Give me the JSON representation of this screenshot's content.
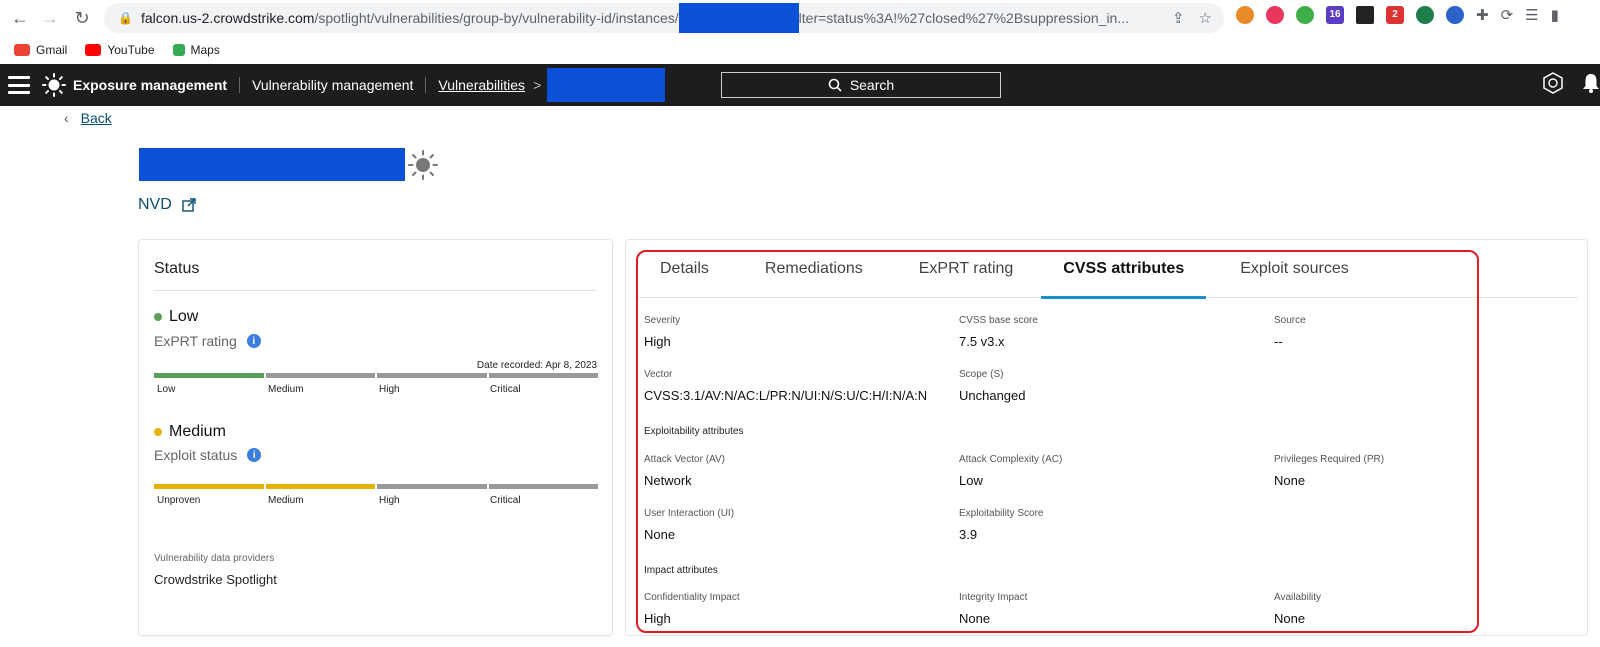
{
  "browser": {
    "url_host": "falcon.us-2.crowdstrike.com",
    "url_path": "/spotlight/vulnerabilities/group-by/vulnerability-id/instances/",
    "url_tail": "lter=status%3A!%27closed%27%2Bsuppression_in...",
    "bookmarks": [
      {
        "label": "Gmail",
        "color": "#ea4335"
      },
      {
        "label": "YouTube",
        "color": "#ff0000"
      },
      {
        "label": "Maps",
        "color": "#34a853"
      }
    ],
    "extension_badges": {
      "badge1": "16",
      "badge2": "2"
    }
  },
  "appbar": {
    "product": "Exposure management",
    "module": "Vulnerability management",
    "section": "Vulnerabilities",
    "separator": ">",
    "search_label": "Search"
  },
  "page": {
    "back_label": "Back",
    "source_link": "NVD"
  },
  "status": {
    "title": "Status",
    "exprt": {
      "value": "Low",
      "label": "ExPRT rating",
      "date_recorded": "Date recorded: Apr 8, 2023",
      "color": "#5a9e5a",
      "segments": [
        "Low",
        "Medium",
        "High",
        "Critical"
      ],
      "filled": 1
    },
    "exploit": {
      "value": "Medium",
      "label": "Exploit status",
      "color": "#e8b10a",
      "segments": [
        "Unproven",
        "Medium",
        "High",
        "Critical"
      ],
      "filled": 2
    },
    "providers_label": "Vulnerability data providers",
    "providers_value": "Crowdstrike Spotlight"
  },
  "tabs": [
    "Details",
    "Remediations",
    "ExPRT rating",
    "CVSS attributes",
    "Exploit sources"
  ],
  "active_tab": "CVSS attributes",
  "cvss": {
    "severity": {
      "k": "Severity",
      "v": "High"
    },
    "base_score": {
      "k": "CVSS base score",
      "v": "7.5 v3.x"
    },
    "source": {
      "k": "Source",
      "v": "--"
    },
    "vector": {
      "k": "Vector",
      "v": "CVSS:3.1/AV:N/AC:L/PR:N/UI:N/S:U/C:H/I:N/A:N"
    },
    "scope": {
      "k": "Scope (S)",
      "v": "Unchanged"
    },
    "exploitability_heading": "Exploitability attributes",
    "attack_vector": {
      "k": "Attack Vector (AV)",
      "v": "Network"
    },
    "attack_complexity": {
      "k": "Attack Complexity (AC)",
      "v": "Low"
    },
    "privileges": {
      "k": "Privileges Required (PR)",
      "v": "None"
    },
    "user_interaction": {
      "k": "User Interaction (UI)",
      "v": "None"
    },
    "exploitability_score": {
      "k": "Exploitability Score",
      "v": "3.9"
    },
    "impact_heading": "Impact attributes",
    "confidentiality": {
      "k": "Confidentiality Impact",
      "v": "High"
    },
    "integrity": {
      "k": "Integrity Impact",
      "v": "None"
    },
    "availability": {
      "k": "Availability",
      "v": "None"
    }
  }
}
